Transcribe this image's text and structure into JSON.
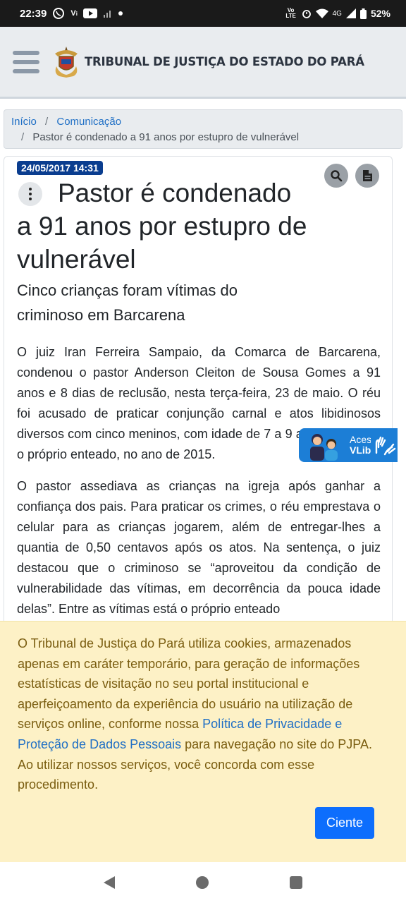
{
  "status_bar": {
    "time": "22:39",
    "carrier_tag": "Vo LTE",
    "network": "4G",
    "battery": "52%"
  },
  "header": {
    "brand_name": "TRIBUNAL DE JUSTIÇA DO ESTADO DO PARÁ"
  },
  "breadcrumb": {
    "items": [
      "Início",
      "Comunicação"
    ],
    "separator": "/",
    "current": "Pastor é condenado a 91 anos por estupro de vulnerável"
  },
  "article": {
    "date": "24/05/2017 14:31",
    "title": "Pastor é condenado a 91 anos por estupro de vulnerável",
    "subtitle": "Cinco crianças foram vítimas do criminoso em Barcarena",
    "paragraphs": [
      "O juiz Iran Ferreira Sampaio, da Comarca de Barcarena, condenou o pastor Anderson Cleiton de Sousa Gomes a 91 anos e 8 dias de reclusão, nesta terça-feira, 23 de maio. O réu foi acusado de praticar conjunção carnal e atos libidinosos diversos com cinco meninos, com idade de 7 a 9 anos, incluindo o próprio enteado, no ano de 2015.",
      "O pastor assediava as crianças na igreja após ganhar a confiança dos pais. Para praticar os crimes, o réu emprestava o celular para as crianças jogarem, além de entregar-lhes a quantia de 0,50 centavos após os atos. Na sentença, o juiz destacou que o criminoso se “aproveitou da condição de vulnerabilidade das vítimas, em decorrência da pouca idade delas”. Entre as vítimas está o próprio enteado"
    ]
  },
  "vlibras": {
    "line1": "Acessível em Libras",
    "line2": "VLibras"
  },
  "cookie": {
    "text_before": "O Tribunal de Justiça do Pará utiliza cookies, armazenados apenas em caráter temporário, para geração de informações estatísticas de visitação no seu portal institucional e aperfeiçoamento da experiência do usuário na utilização de serviços online, conforme nossa ",
    "link": "Política de Privacidade e Proteção de Dados Pessoais",
    "text_after": " para navegação no site do PJPA. Ao utilizar nossos serviços, você concorda com esse procedimento.",
    "button": "Ciente"
  },
  "colors": {
    "badge": "#0a3d8f",
    "link": "#1f6fc5",
    "cookie_bg": "#fdf1c6",
    "primary_button": "#0d6efd"
  }
}
